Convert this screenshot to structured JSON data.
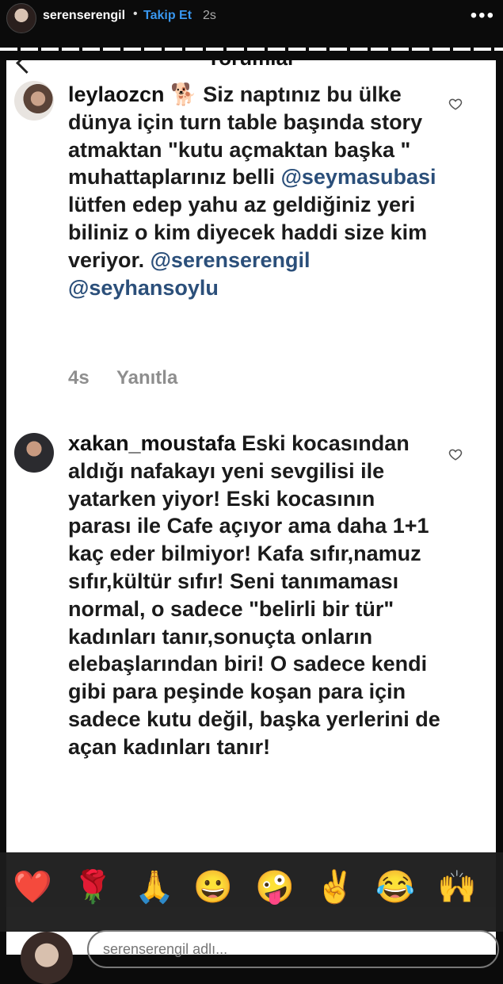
{
  "header": {
    "username": "serenserengil",
    "dot": "•",
    "follow_label": "Takip Et",
    "time": "2s",
    "more": "•••"
  },
  "panel": {
    "title": "Yorumlar"
  },
  "comments": [
    {
      "user": "leylaozcn",
      "emoji": "🐕",
      "text_before": "Siz naptınız bu ülke dünya için turn table başında story atmaktan \"kutu açmaktan başka \" muhattaplarınız belli",
      "mention1": "@seymasubasi",
      "text_middle": "lütfen edep yahu az geldiğiniz yeri biliniz o kim diyecek haddi size kim veriyor.",
      "mention2": "@serenserengil",
      "mention3": "@seyhansoylu",
      "time": "4s",
      "reply_label": "Yanıtla"
    },
    {
      "user": "xakan_moustafa",
      "text": "Eski kocasından aldığı nafakayı yeni sevgilisi ile yatarken yiyor! Eski kocasının parası ile Cafe açıyor ama daha 1+1 kaç eder bilmiyor! Kafa sıfır,namuz sıfır,kültür sıfır! Seni tanımaması normal, o sadece \"belirli bir tür\" kadınları tanır,sonuçta onların elebaşlarından biri! O sadece kendi gibi para peşinde koşan para için sadece kutu değil, başka yerlerini de açan kadınları tanır!"
    }
  ],
  "emoji_bar": [
    "❤️",
    "🌹",
    "🙏",
    "😀",
    "🤪",
    "✌️",
    "😂",
    "🙌"
  ],
  "reply": {
    "placeholder": "serenserengil adlı..."
  }
}
